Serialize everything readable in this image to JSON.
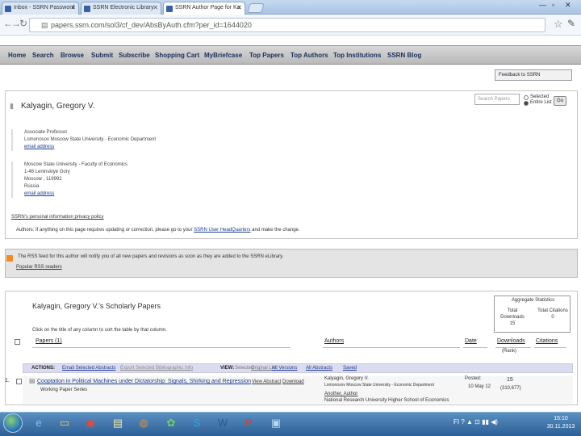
{
  "browser": {
    "tabs": [
      {
        "label": "Inbox - SSRN Password"
      },
      {
        "label": "SSRN Electronic Library"
      },
      {
        "label": "SSRN Author Page for Ka"
      },
      {
        "label": ""
      }
    ],
    "url": "papers.ssrn.com/sol3/cf_dev/AbsByAuth.cfm?per_id=1644020",
    "window_controls": [
      "—",
      "▫",
      "✕"
    ]
  },
  "ssrn_nav": [
    "Home",
    "Search",
    "Browse",
    "Submit",
    "Subscribe",
    "Shopping Cart",
    "MyBriefcase",
    "Top Papers",
    "Top Authors",
    "Top Institutions",
    "SSRN Blog"
  ],
  "feedback": "Feedback to SSRN",
  "author": {
    "name": "Kalyagin, Gregory V.",
    "search_placeholder": "Search Papers",
    "radio_selected": "Selected",
    "radio_entire": "Entire List",
    "go_label": "Go",
    "affiliation1": {
      "title": "Associate Professor",
      "org": "Lomonosov Moscow State University - Economic Department",
      "email": "email address"
    },
    "affiliation2": {
      "org": "Moscow State University - Faculty of Economics",
      "line1": "1-46 Leninskiye Gory",
      "line2": "Moscow , 119992",
      "line3": "Russia",
      "email": "email address"
    },
    "privacy_link": "SSRN's personal information privacy policy",
    "authors_note_prefix": "Authors: If anything on this page requires updating or correction, please go to your ",
    "authors_note_link": "SSRN User HeadQuarters",
    "authors_note_suffix": " and make the change."
  },
  "rss": {
    "text": "The RSS feed for this author will notify you of all new papers and revisions as soon as they are added to the SSRN eLibrary.",
    "link": "Popular RSS readers"
  },
  "papers": {
    "title": "Kalyagin, Gregory V.'s Scholarly Papers",
    "instruction": "Click on the title of any column to sort the table by that column.",
    "aggregate": {
      "heading": "Aggregate Statistics",
      "downloads_label": "Total Downloads",
      "downloads_value": "15",
      "citations_label": "Total Citations",
      "citations_value": "0"
    },
    "columns": [
      "Papers (1)",
      "Authors",
      "Date",
      "Downloads",
      "Citations"
    ],
    "rank_label": "(Rank)",
    "actions": {
      "label": "ACTIONS:",
      "email": "Email Selected Abstracts",
      "export": "Export Selected Bibliographic Info",
      "view_label": "VIEW:",
      "selected": "Selected",
      "original": "Original List",
      "all_versions": "All Versions",
      "all_abstracts": "All Abstracts",
      "saved": "Saved"
    },
    "rows": [
      {
        "num": "1.",
        "title": "Cooptation in Political Machines under Dictatorship: Signals, Shirking and Repression",
        "view_abstract": "View Abstract",
        "download": "Download",
        "series": "Working Paper Series",
        "author": "Kalyagin, Gregory V.",
        "author_aff": "Lomonosov Moscow State University - Economic Department",
        "coauthor": "Another, Author",
        "coauthor_aff": "National Research University Higher School of Economics",
        "date_label": "Posted:",
        "date": "10 May 12",
        "downloads": "15",
        "rank": "(310,677)"
      }
    ]
  },
  "taskbar": {
    "tray": "FI  ?  ▲ ⊡ ▮▮ ◀)",
    "time": "15:10",
    "date": "30.11.2013"
  }
}
